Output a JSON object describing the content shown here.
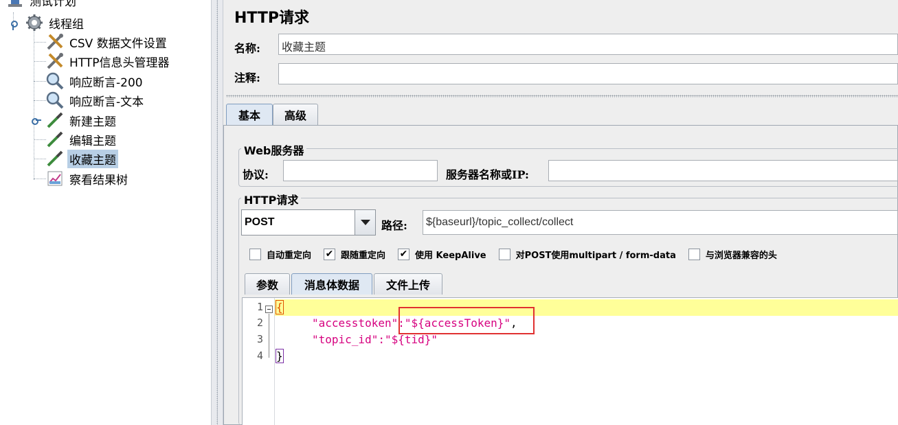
{
  "tree": {
    "items": [
      {
        "label": "测试计划"
      },
      {
        "label": "线程组"
      },
      {
        "label": "CSV 数据文件设置"
      },
      {
        "label": "HTTP信息头管理器"
      },
      {
        "label": "响应断言-200"
      },
      {
        "label": "响应断言-文本"
      },
      {
        "label": "新建主题"
      },
      {
        "label": "编辑主题"
      },
      {
        "label": "收藏主题"
      },
      {
        "label": "察看结果树"
      }
    ],
    "selected_index": 8
  },
  "panel": {
    "title": "HTTP请求",
    "name_label": "名称:",
    "name_value": "收藏主题",
    "comment_label": "注释:",
    "comment_value": "",
    "tabs": [
      {
        "label": "基本"
      },
      {
        "label": "高级"
      }
    ],
    "web_server": {
      "group_title": "Web服务器",
      "protocol_label": "协议:",
      "protocol_value": "",
      "server_label": "服务器名称或IP:",
      "server_value": ""
    },
    "http_request": {
      "group_title": "HTTP请求",
      "method": "POST",
      "path_label": "路径:",
      "path_value": "${baseurl}/topic_collect/collect"
    },
    "checkboxes": [
      {
        "label": "自动重定向",
        "checked": false,
        "mark": ""
      },
      {
        "label": "跟随重定向",
        "checked": true,
        "mark": "✔"
      },
      {
        "label": "使用 KeepAlive",
        "checked": true,
        "mark": "✔"
      },
      {
        "label": "对POST使用multipart / form-data",
        "checked": false,
        "mark": ""
      },
      {
        "label": "与浏览器兼容的头",
        "checked": false,
        "mark": ""
      }
    ],
    "body_tabs": [
      {
        "label": "参数"
      },
      {
        "label": "消息体数据"
      },
      {
        "label": "文件上传"
      }
    ],
    "editor": {
      "line_numbers": [
        "1",
        "2",
        "3",
        "4"
      ],
      "open_brace": "{",
      "close_brace": "}",
      "line2_key": "\"accesstoken\"",
      "line2_sep": ":",
      "line2_value": "\"${accessToken}\"",
      "line2_comma": ",",
      "line3_key": "\"topic_id\"",
      "line3_sep": ":",
      "line3_value": "\"${tid}\""
    }
  },
  "colors": {
    "selection": "#b8cfe5",
    "string": "#d6007f",
    "highlight_line": "#ffff99",
    "annotation_box": "#e03030"
  }
}
